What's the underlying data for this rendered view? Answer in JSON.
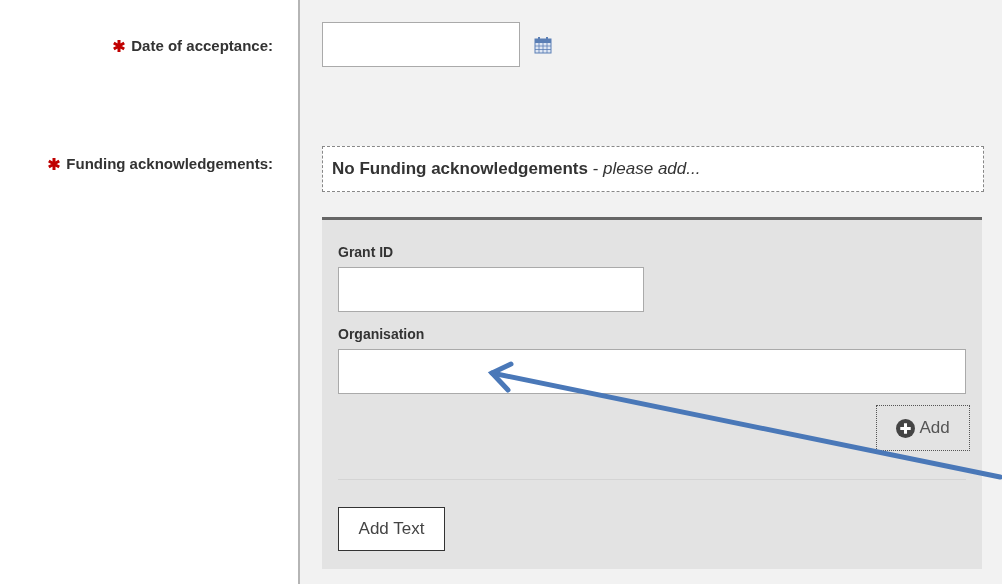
{
  "date_field": {
    "label": "Date of acceptance:",
    "required": true
  },
  "funding": {
    "label": "Funding acknowledgements:",
    "required": true,
    "empty_message": "**No Funding acknowledgements** - *please add...*",
    "form": {
      "fields": [
        {
          "label": "Grant ID",
          "kind": "short"
        },
        {
          "label": "Organisation",
          "kind": "wide"
        }
      ],
      "add_button": "Add",
      "add_text_button": "Add Text"
    }
  },
  "annotation": {
    "kind": "arrow"
  }
}
